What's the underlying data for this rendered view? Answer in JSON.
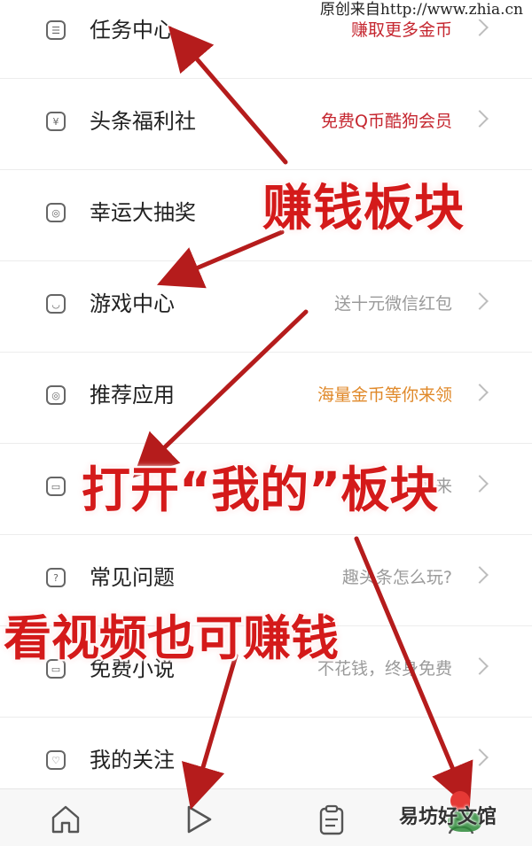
{
  "watermark_top": "原创来自http://www.zhia.cn",
  "menu_items": [
    {
      "label": "任务中心",
      "hint": "赚取更多金币",
      "hint_style": "red",
      "icon": "task-list-icon",
      "glyph": "☰"
    },
    {
      "label": "头条福利社",
      "hint": "免费Q币酷狗会员",
      "hint_style": "red",
      "icon": "yen-coupon-icon",
      "glyph": "¥"
    },
    {
      "label": "幸运大抽奖",
      "hint": "",
      "hint_style": "gray",
      "icon": "lottery-icon",
      "glyph": "◎"
    },
    {
      "label": "游戏中心",
      "hint": "送十元微信红包",
      "hint_style": "gray",
      "icon": "game-controller-icon",
      "glyph": "◡"
    },
    {
      "label": "推荐应用",
      "hint": "海量金币等你来领",
      "hint_style": "orange",
      "icon": "app-icon",
      "glyph": "◎"
    },
    {
      "label": "",
      "hint": "就来",
      "hint_style": "gray",
      "icon": "box-icon",
      "glyph": "▭"
    },
    {
      "label": "常见问题",
      "hint": "趣头条怎么玩?",
      "hint_style": "gray",
      "icon": "question-icon",
      "glyph": "?"
    },
    {
      "label": "免费小说",
      "hint": "不花钱，终身免费",
      "hint_style": "gray",
      "icon": "book-icon",
      "glyph": "▭"
    },
    {
      "label": "我的关注",
      "hint": "",
      "hint_style": "gray",
      "icon": "heart-icon",
      "glyph": "♡"
    }
  ],
  "tabbar": {
    "tabs": [
      {
        "name": "home",
        "icon": "home-icon"
      },
      {
        "name": "video",
        "icon": "play-icon"
      },
      {
        "name": "tasks",
        "icon": "clipboard-icon"
      },
      {
        "name": "mine",
        "icon": "person-icon"
      }
    ]
  },
  "annotations": {
    "caption_earn": "赚钱板块",
    "caption_open_mine": "打开“我的”板块",
    "caption_video": "看视频也可赚钱",
    "arrow_color": "#b51c1c"
  },
  "watermark_bottom": "易坊好文馆"
}
